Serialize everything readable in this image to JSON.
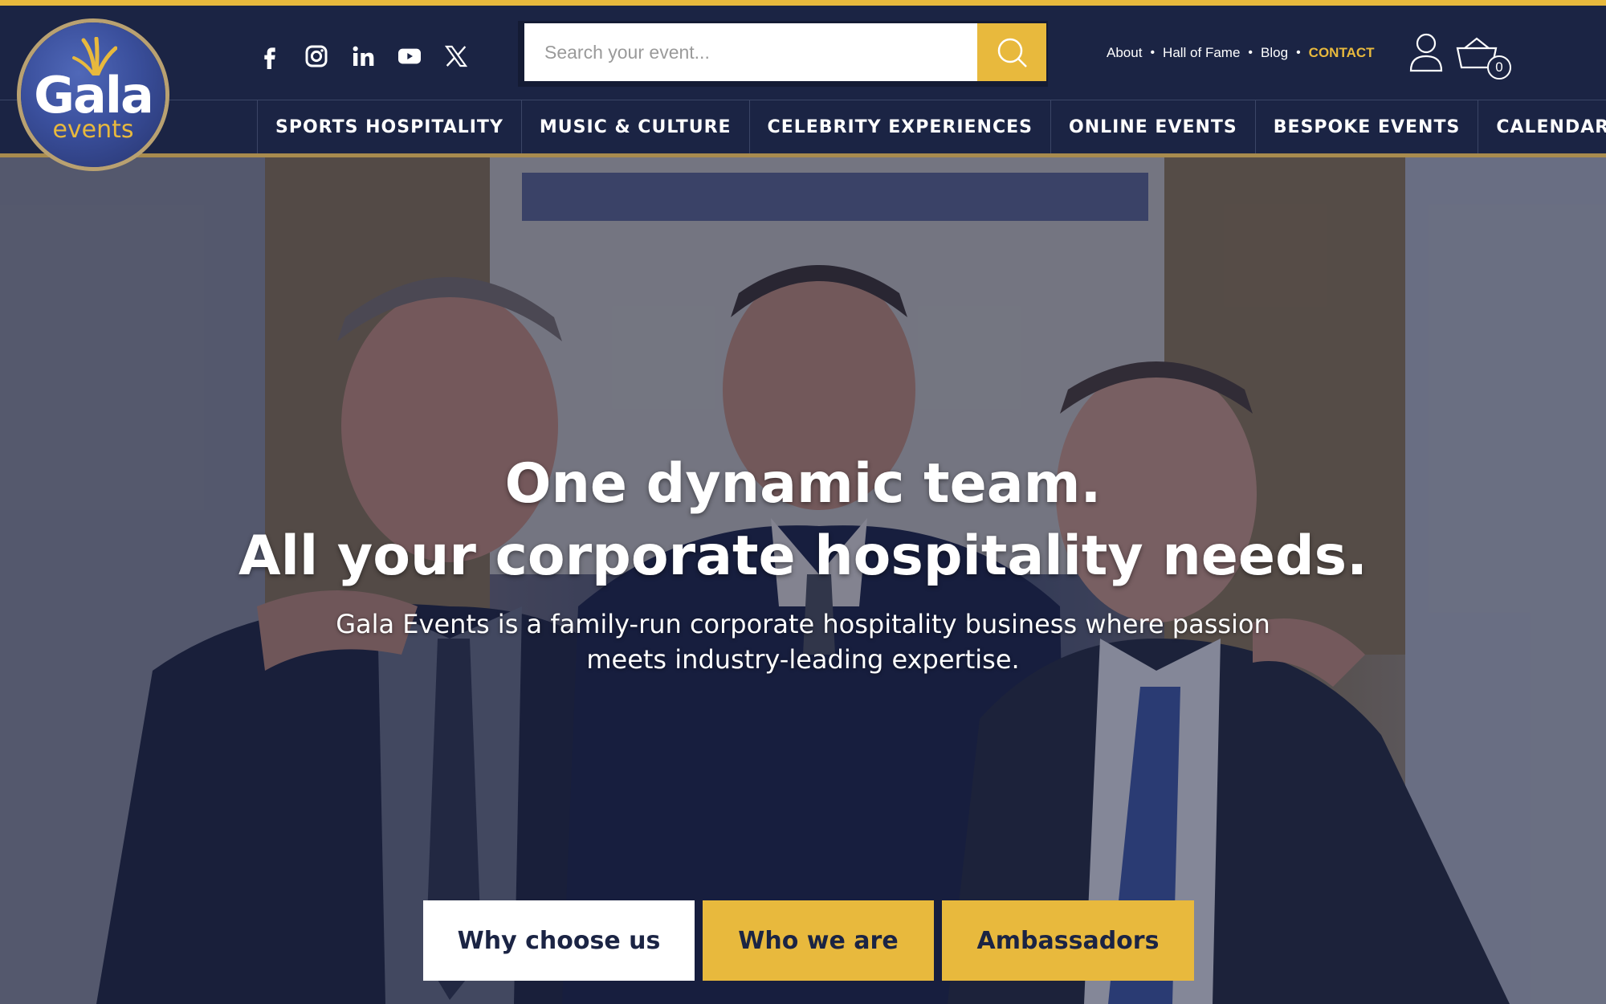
{
  "brand": {
    "logo_main": "Gala",
    "logo_sub": "events",
    "colors": {
      "navy": "#1b2444",
      "gold": "#e8b93d",
      "white": "#ffffff"
    }
  },
  "header": {
    "socials": [
      {
        "name": "facebook",
        "icon": "facebook-icon"
      },
      {
        "name": "instagram",
        "icon": "instagram-icon"
      },
      {
        "name": "linkedin",
        "icon": "linkedin-icon"
      },
      {
        "name": "youtube",
        "icon": "youtube-icon"
      },
      {
        "name": "x",
        "icon": "x-twitter-icon"
      }
    ],
    "search": {
      "placeholder": "Search your event...",
      "value": ""
    },
    "toplinks": {
      "about": "About",
      "hall_of_fame": "Hall of Fame",
      "blog": "Blog",
      "contact": "CONTACT"
    },
    "basket_count": "0"
  },
  "nav": {
    "items": [
      "SPORTS HOSPITALITY",
      "MUSIC & CULTURE",
      "CELEBRITY EXPERIENCES",
      "ONLINE EVENTS",
      "BESPOKE EVENTS",
      "CALENDAR"
    ]
  },
  "hero": {
    "headline_1": "One dynamic team.",
    "headline_2": "All your corporate hospitality needs.",
    "subtitle": "Gala Events is a family-run corporate hospitality business where passion meets industry-leading expertise.",
    "buttons": {
      "why": "Why choose us",
      "who": "Who we are",
      "ambassadors": "Ambassadors"
    }
  }
}
